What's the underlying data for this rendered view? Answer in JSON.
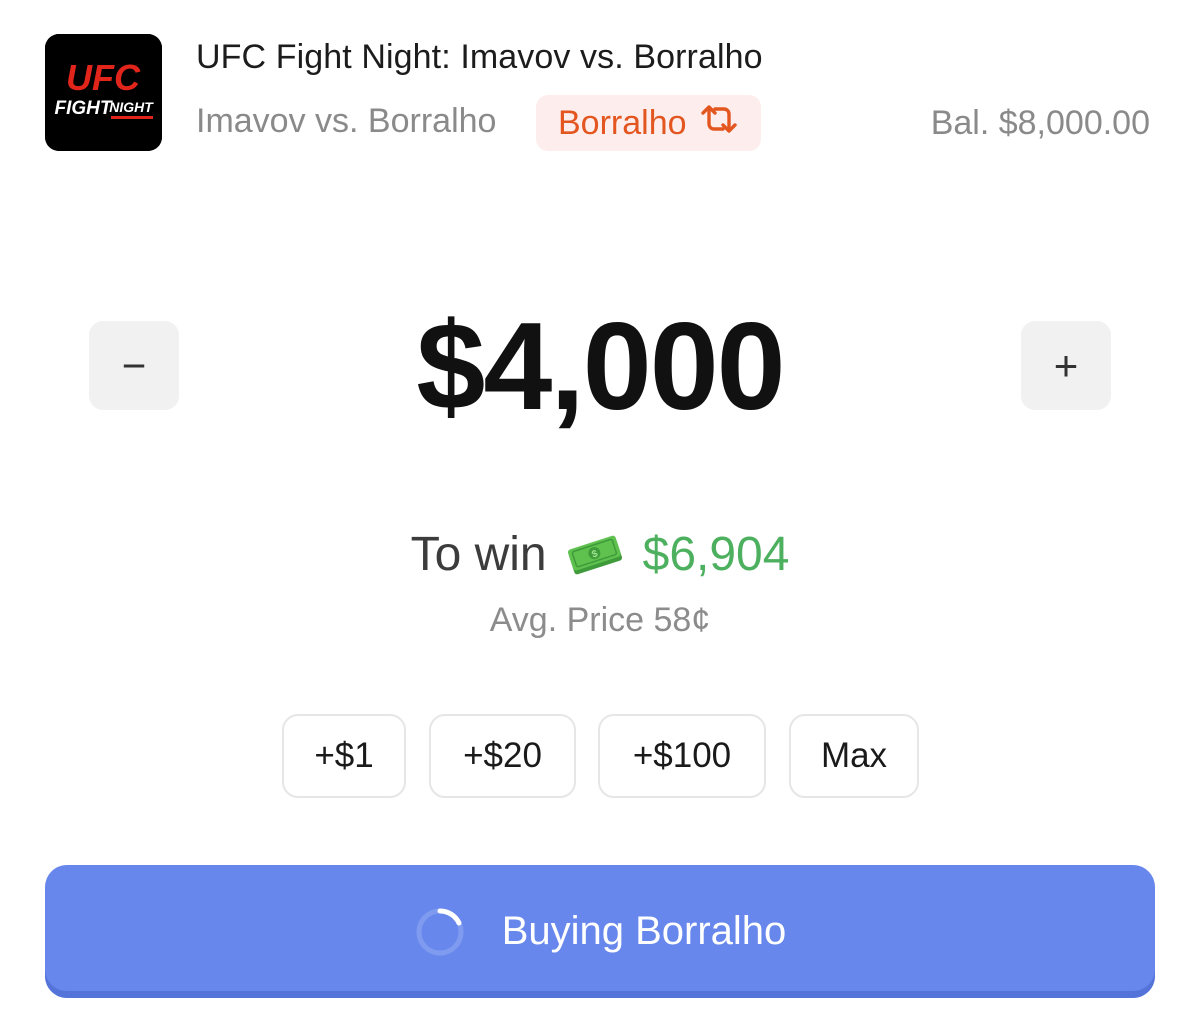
{
  "header": {
    "logo": {
      "line1": "UFC",
      "line2": "FIGHT",
      "line3": "NIGHT",
      "bg_color": "#000000",
      "accent_color": "#e1251b"
    },
    "event_title": "UFC Fight Night: Imavov vs. Borralho",
    "matchup": "Imavov vs. Borralho",
    "pick": {
      "label": "Borralho",
      "icon": "swap-icon",
      "color": "#e3561f",
      "bg": "#fdeeed"
    },
    "balance": "Bal. $8,000.00"
  },
  "amount": {
    "value": "$4,000",
    "decrement_label": "−",
    "increment_label": "+"
  },
  "payout": {
    "label": "To win",
    "icon": "money-icon",
    "value": "$6,904",
    "value_color": "#4cb05f",
    "avg_price": "Avg. Price 58¢"
  },
  "quick_add": [
    {
      "label": "+$1"
    },
    {
      "label": "+$20"
    },
    {
      "label": "+$100"
    },
    {
      "label": "Max"
    }
  ],
  "buy_button": {
    "label": "Buying Borralho",
    "icon": "spinner-icon",
    "bg": "#6787ec"
  }
}
